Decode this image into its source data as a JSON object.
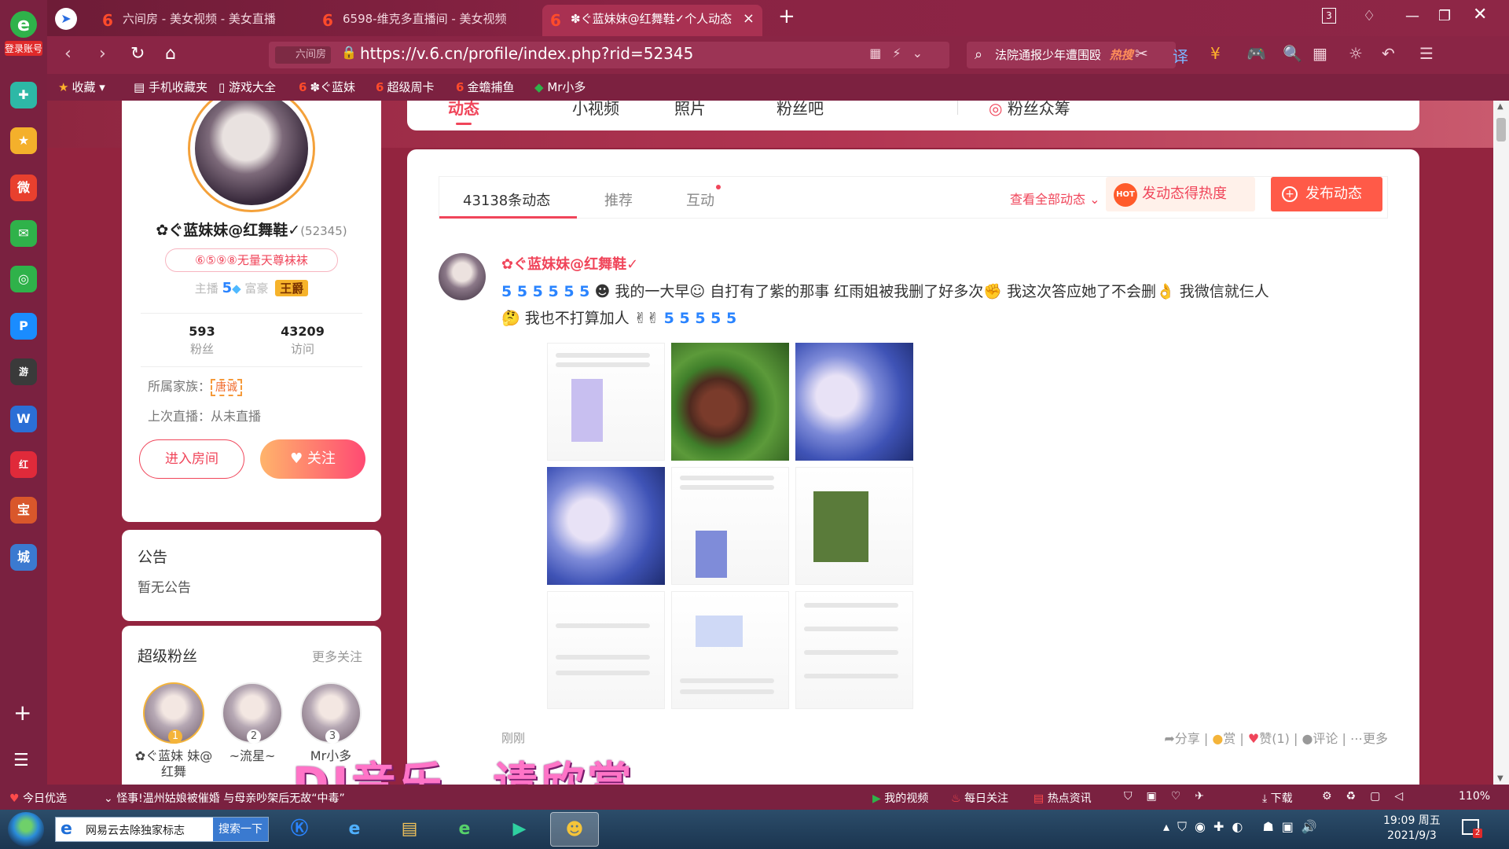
{
  "sidebar": {
    "login_label": "登录账号",
    "apps": [
      {
        "icon": "plus-circle-icon",
        "color": "#2db8a6",
        "glyph": "✚"
      },
      {
        "icon": "star-icon",
        "color": "#f4b02b",
        "glyph": "★"
      },
      {
        "icon": "weibo-icon",
        "color": "#e8402e",
        "glyph": "微"
      },
      {
        "icon": "mail-icon",
        "color": "#2fb24a",
        "glyph": "✉"
      },
      {
        "icon": "chat-icon",
        "color": "#2fb24a",
        "glyph": "◎"
      },
      {
        "icon": "p-app-icon",
        "color": "#1a8cff",
        "glyph": "P"
      },
      {
        "icon": "game-icon",
        "color": "#3a3a3a",
        "glyph": "游"
      },
      {
        "icon": "doc-icon",
        "color": "#2b6fd6",
        "glyph": "W"
      },
      {
        "icon": "red-book-icon",
        "color": "#e02a3a",
        "glyph": "红"
      },
      {
        "icon": "treasure-icon",
        "color": "#d9572b",
        "glyph": "宝"
      },
      {
        "icon": "city-game-icon",
        "color": "#3b7ad0",
        "glyph": "城"
      }
    ]
  },
  "tabs": [
    {
      "title": "六间房 - 美女视频 - 美女直播"
    },
    {
      "title": "6598-维克多直播间 - 美女视频"
    },
    {
      "title": "✽ぐ蓝妹妹@红舞鞋✓个人动态"
    }
  ],
  "window": {
    "tab_count": "3"
  },
  "address": {
    "site_label": "六间房",
    "url": "https://v.6.cn/profile/index.php?rid=52345",
    "search_text": "法院通报少年遭围殴",
    "search_hot": "热搜"
  },
  "bookmarks": [
    "收藏",
    "手机收藏夹",
    "游戏大全",
    "✽ぐ蓝妹",
    "超级周卡",
    "金蟾捕鱼",
    "Mr小多"
  ],
  "profile_nav": [
    "动态",
    "小视频",
    "照片",
    "粉丝吧",
    "粉丝众筹"
  ],
  "profile": {
    "nickname": "✿ぐ蓝妹妹@红舞鞋✓",
    "rid": "(52345)",
    "fanclub": "⑥⑤⑨⑧无量天尊袜袜",
    "anchor_label": "主播",
    "anchor_level": "5",
    "rich_label": "富豪",
    "rich_badge": "王爵",
    "fans_count": "593",
    "fans_label": "粉丝",
    "visits_count": "43209",
    "visits_label": "访问",
    "family_label": "所属家族：",
    "family_tag": "唐诚",
    "last_live": "上次直播：从未直播",
    "enter_room": "进入房间",
    "follow": "关注"
  },
  "notice": {
    "title": "公告",
    "content": "暂无公告"
  },
  "super_fans": {
    "title": "超级粉丝",
    "more": "更多关注",
    "fans": [
      {
        "rank": "1",
        "name": "✿ぐ蓝妹 妹@红舞"
      },
      {
        "rank": "2",
        "name": "~流星~"
      },
      {
        "rank": "3",
        "name": "Mr小多"
      }
    ]
  },
  "feed": {
    "tabs": [
      "43138条动态",
      "推荐",
      "互动"
    ],
    "view_all": "查看全部动态",
    "heat_button": "发动态得热度",
    "post_button": "发布动态",
    "post": {
      "author": "✿ぐ蓝妹妹@红舞鞋✓",
      "emoji_prefix": "5 5 5 5 5 5",
      "text_a": "我的一大早",
      "text_b": "自打有了紫的那事",
      "text_c": "红雨姐被我删了好多次",
      "text_d": "我这次答应她了不会删",
      "text_e": "我微信就仨人",
      "text_f": "我也不打算加人",
      "emoji_suffix": "5 5 5 5 5",
      "time": "刚刚",
      "share": "分享",
      "reward": "赏",
      "like": "赞(1)",
      "comment": "评论",
      "more": "更多"
    }
  },
  "overlay_caption": "DJ音乐，请欣赏",
  "statusbar": {
    "daily": "今日优选",
    "news": "怪事!温州姑娘被催婚 与母亲吵架后无故“中毒”",
    "my_video": "我的视频",
    "daily_follow": "每日关注",
    "hot_news": "热点资讯",
    "download": "下载",
    "zoom": "110%"
  },
  "taskbar": {
    "ie_search_text": "网易云去除独家标志",
    "ie_search_button": "搜索一下",
    "time": "19:09 周五",
    "date": "2021/9/3",
    "notif_count": "2"
  }
}
